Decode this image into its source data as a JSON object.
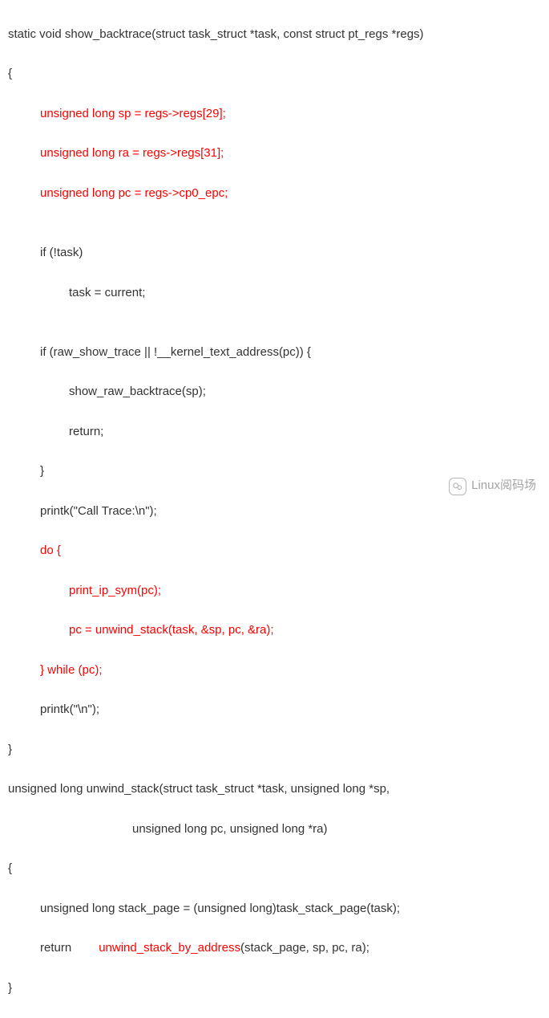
{
  "code": {
    "l1": "static void show_backtrace(struct task_struct *task, const struct pt_regs *regs)",
    "l2": "{",
    "l3": "unsigned long sp = regs->regs[29];",
    "l4": "unsigned long ra = regs->regs[31];",
    "l5": "unsigned long pc = regs->cp0_epc;",
    "l6": "",
    "l7": "if (!task)",
    "l8": "task = current;",
    "l9": "",
    "l10": "if (raw_show_trace || !__kernel_text_address(pc)) {",
    "l11": "show_raw_backtrace(sp);",
    "l12": "return;",
    "l13": "}",
    "l14": "printk(\"Call Trace:\\n\");",
    "l15": "do {",
    "l16": "print_ip_sym(pc);",
    "l17": "pc = unwind_stack(task, &sp, pc, &ra);",
    "l18": "} while (pc);",
    "l19": "printk(\"\\n\");",
    "l20": "}",
    "l21": "unsigned long unwind_stack(struct task_struct *task, unsigned long *sp,",
    "l22": "unsigned long pc, unsigned long *ra)",
    "l23": "{",
    "l24": "unsigned long stack_page = (unsigned long)task_stack_page(task);",
    "l25a": "return",
    "l25b": "unwind_stack_by_address",
    "l25c": "(stack_page, sp, pc, ra);",
    "l26": "}"
  },
  "watermark": {
    "text": "Linux阅码场"
  }
}
